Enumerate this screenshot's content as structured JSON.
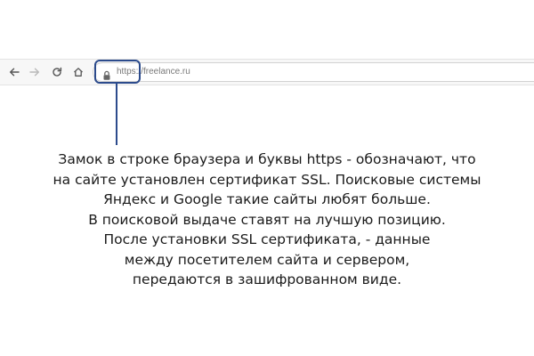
{
  "browser": {
    "address_bar": {
      "url_scheme": "https://",
      "url_host": "freelance.ru"
    },
    "icons": {
      "back": "back-arrow-icon",
      "forward": "forward-arrow-icon",
      "reload": "reload-icon",
      "home": "home-icon",
      "lock": "lock-icon"
    }
  },
  "colors": {
    "highlight": "#2c4b8c",
    "text": "#1a1a1a"
  },
  "explanation": {
    "lines": [
      "Замок в строке браузера и буквы https - обозначают, что",
      "на сайте установлен сертификат SSL. Поисковые системы",
      "Яндекс и Google такие сайты любят больше.",
      "В поисковой выдаче ставят на лучшую позицию.",
      "После установки SSL сертификата, - данные",
      "между посетителем сайта и сервером,",
      "передаются в зашифрованном виде."
    ]
  }
}
